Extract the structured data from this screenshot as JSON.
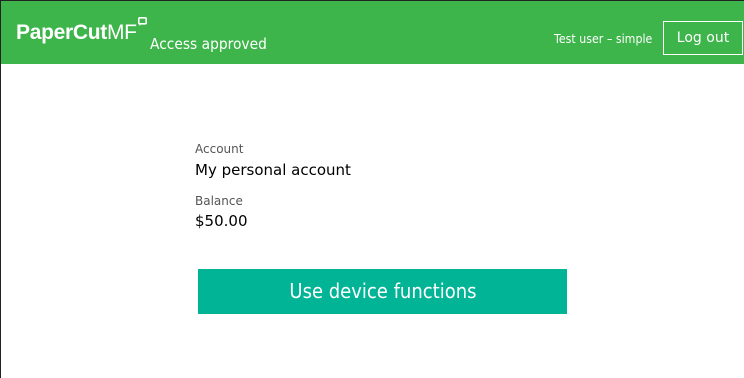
{
  "header": {
    "logo_bold": "PaperCut",
    "logo_light": "MF",
    "status": "Access approved",
    "user": "Test user – simple",
    "logout_label": "Log out"
  },
  "account": {
    "label": "Account",
    "value": "My personal account"
  },
  "balance": {
    "label": "Balance",
    "value": "$50.00"
  },
  "actions": {
    "use_device_label": "Use device functions"
  },
  "colors": {
    "header_green": "#3db54a",
    "button_teal": "#00b495"
  }
}
